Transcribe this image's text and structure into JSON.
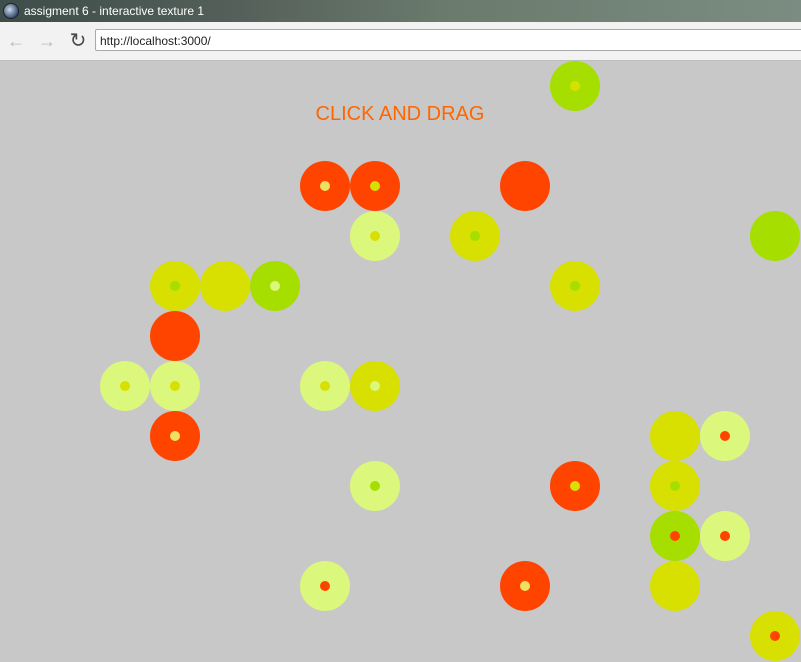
{
  "window": {
    "title": "assigment 6 - interactive texture 1"
  },
  "toolbar": {
    "back_icon": "back-arrow-icon",
    "forward_icon": "forward-arrow-icon",
    "reload_icon": "reload-icon",
    "url": "http://localhost:3000/"
  },
  "canvas": {
    "headline": "CLICK AND DRAG",
    "colors": {
      "red": "#ff4400",
      "yellow": "#d7e000",
      "pale": "#dbf77c",
      "green": "#a6de00",
      "innerYellow": "#f0e060"
    },
    "circles": [
      {
        "fill": "green",
        "center": "yellow"
      },
      {
        "fill": "red",
        "center": "innerYellow"
      },
      {
        "fill": "red",
        "center": "yellow"
      },
      {
        "fill": "red",
        "center": null
      },
      {
        "fill": "pale",
        "center": "yellow"
      },
      {
        "fill": "yellow",
        "center": "green"
      },
      {
        "fill": "green",
        "center": null
      },
      {
        "fill": "yellow",
        "center": "green"
      },
      {
        "fill": "yellow",
        "center": null
      },
      {
        "fill": "green",
        "center": "pale"
      },
      {
        "fill": "yellow",
        "center": "green"
      },
      {
        "fill": "red",
        "center": null
      },
      {
        "fill": "pale",
        "center": "yellow"
      },
      {
        "fill": "pale",
        "center": "yellow"
      },
      {
        "fill": "pale",
        "center": "yellow"
      },
      {
        "fill": "yellow",
        "center": "pale"
      },
      {
        "fill": "red",
        "center": "innerYellow"
      },
      {
        "fill": "yellow",
        "center": null
      },
      {
        "fill": "pale",
        "center": "red"
      },
      {
        "fill": "pale",
        "center": "green"
      },
      {
        "fill": "red",
        "center": "yellow"
      },
      {
        "fill": "yellow",
        "center": "green"
      },
      {
        "fill": "green",
        "center": "red"
      },
      {
        "fill": "pale",
        "center": "red"
      },
      {
        "fill": "pale",
        "center": "red"
      },
      {
        "fill": "red",
        "center": "innerYellow"
      },
      {
        "fill": "yellow",
        "center": null
      },
      {
        "fill": "yellow",
        "center": "red"
      }
    ]
  }
}
